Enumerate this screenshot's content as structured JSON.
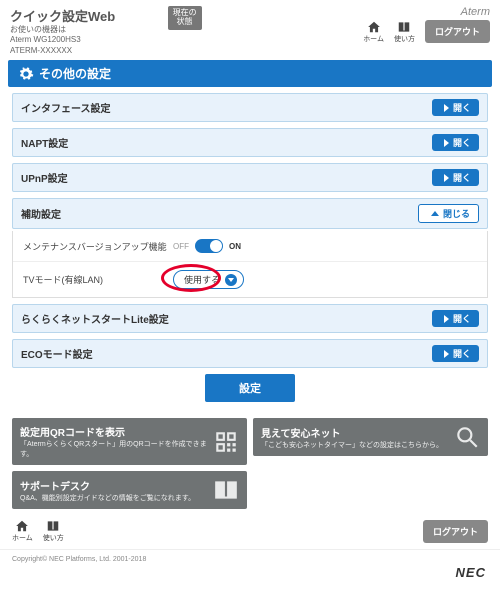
{
  "header": {
    "title": "クイック設定Web",
    "sub1": "お使いの機器は",
    "sub2": "Aterm WG1200HS3",
    "sub3": "ATERM-XXXXXX",
    "status_btn": "現在の\n状態",
    "brand": "Aterm",
    "home": "ホーム",
    "usage": "使い方",
    "logout": "ログアウト"
  },
  "section_title": "その他の設定",
  "open": "開く",
  "close": "閉じる",
  "panels": {
    "p1": "インタフェース設定",
    "p2": "NAPT設定",
    "p3": "UPnP設定",
    "p4": "補助設定",
    "p5": "らくらくネットスタートLite設定",
    "p6": "ECOモード設定"
  },
  "aux": {
    "r1": "メンテナンスバージョンアップ機能",
    "off": "OFF",
    "on": "ON",
    "r2": "TVモード(有線LAN)",
    "dd": "使用する"
  },
  "set_btn": "設定",
  "cards": {
    "qr_t": "設定用QRコードを表示",
    "qr_d": "「AtermらくらくQRスタート」用のQRコードを作成できます。",
    "sp_t": "サポートデスク",
    "sp_d": "Q&A、機能別設定ガイドなどの情報をご覧になれます。",
    "an_t": "見えて安心ネット",
    "an_d": "「こども安心ネットタイマー」などの設定はこちらから。"
  },
  "copyright": "Copyright© NEC Platforms, Ltd. 2001-2018",
  "nec": "NEC"
}
